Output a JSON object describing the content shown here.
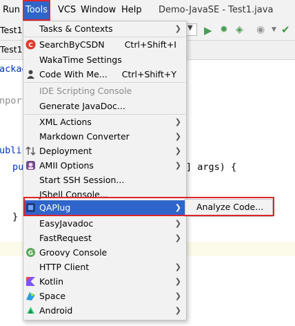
{
  "menubar": {
    "run": "Run",
    "tools": "Tools",
    "vcs": "VCS",
    "window": "Window",
    "help": "Help",
    "title": "Demo-JavaSE - Test1.java"
  },
  "toolbar": {
    "run_config": "Test1"
  },
  "editor": {
    "tab_label": "Test1",
    "lines": [
      "ackag",
      "nport",
      "ublic",
      "pu",
      "] args) {",
      "}"
    ]
  },
  "tools_menu": {
    "items": [
      {
        "label": "Tasks & Contexts",
        "shortcut": "",
        "submenu": true,
        "icon": ""
      },
      {
        "label": "SearchByCSDN",
        "shortcut": "Ctrl+Shift+I",
        "submenu": false,
        "icon": "csdn-icon"
      },
      {
        "label": "WakaTime Settings",
        "shortcut": "",
        "submenu": false,
        "icon": ""
      },
      {
        "label": "Code With Me...",
        "shortcut": "Ctrl+Shift+Y",
        "submenu": false,
        "icon": "user-icon"
      },
      {
        "label": "IDE Scripting Console",
        "shortcut": "",
        "submenu": false,
        "icon": "",
        "disabled": true
      },
      {
        "label": "Generate JavaDoc...",
        "shortcut": "",
        "submenu": false,
        "icon": ""
      },
      {
        "label": "XML Actions",
        "shortcut": "",
        "submenu": true,
        "icon": ""
      },
      {
        "label": "Markdown Converter",
        "shortcut": "",
        "submenu": true,
        "icon": ""
      },
      {
        "label": "Deployment",
        "shortcut": "",
        "submenu": true,
        "icon": "deploy-icon"
      },
      {
        "label": "AMII Options",
        "shortcut": "",
        "submenu": true,
        "icon": "amii-icon"
      },
      {
        "label": "Start SSH Session...",
        "shortcut": "",
        "submenu": false,
        "icon": ""
      },
      {
        "label": "JShell Console...",
        "shortcut": "",
        "submenu": false,
        "icon": ""
      },
      {
        "label": "QAPlug",
        "shortcut": "",
        "submenu": true,
        "icon": "qaplug-icon",
        "selected": true
      },
      {
        "label": "EasyJavadoc",
        "shortcut": "",
        "submenu": true,
        "icon": ""
      },
      {
        "label": "FastRequest",
        "shortcut": "",
        "submenu": true,
        "icon": ""
      },
      {
        "label": "Groovy Console",
        "shortcut": "",
        "submenu": false,
        "icon": "groovy-icon"
      },
      {
        "label": "HTTP Client",
        "shortcut": "",
        "submenu": true,
        "icon": ""
      },
      {
        "label": "Kotlin",
        "shortcut": "",
        "submenu": true,
        "icon": "kotlin-icon"
      },
      {
        "label": "Space",
        "shortcut": "",
        "submenu": true,
        "icon": "space-icon"
      },
      {
        "label": "Android",
        "shortcut": "",
        "submenu": true,
        "icon": "android-icon"
      }
    ]
  },
  "qaplug_submenu": {
    "item": "Analyze Code..."
  },
  "colors": {
    "selection": "#2f65ca",
    "highlight_border": "#e0232b",
    "menu_bg": "#f2f2f2"
  }
}
